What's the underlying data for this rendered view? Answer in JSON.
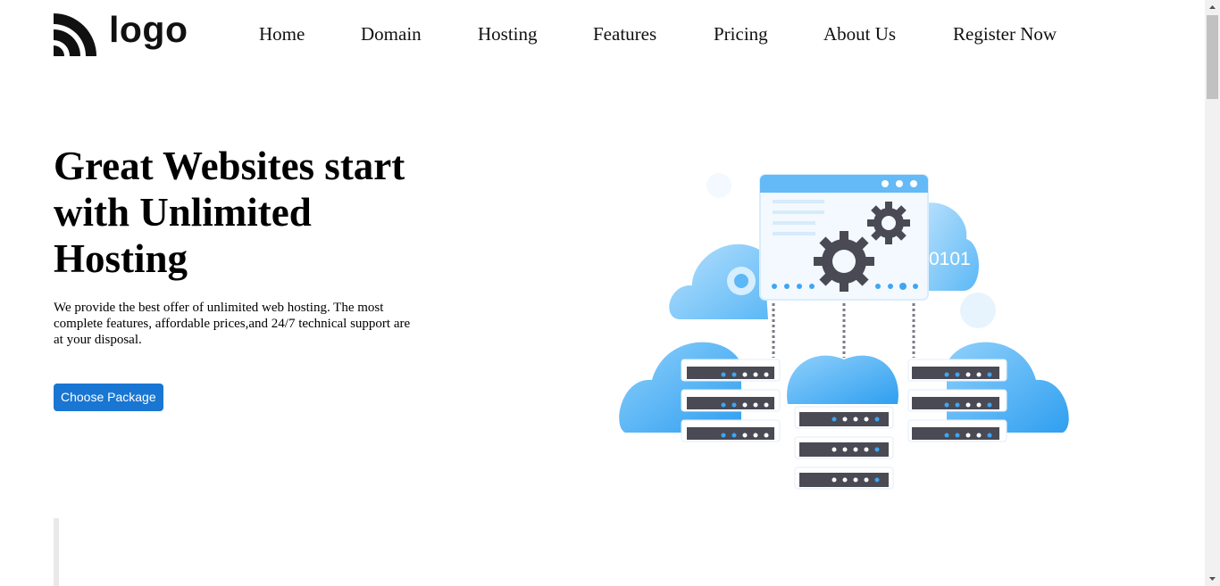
{
  "brand": {
    "logo_text": "logo"
  },
  "nav": {
    "items": [
      "Home",
      "Domain",
      "Hosting",
      "Features",
      "Pricing",
      "About Us",
      "Register Now"
    ]
  },
  "hero": {
    "headline": "Great Websites start with Unlimited Hosting",
    "subtext": "We provide the best offer of unlimited web hosting. The most complete features, affordable prices,and 24/7 technical support are at your disposal.",
    "cta_label": "Choose Package",
    "illustration_text": "0101"
  },
  "colors": {
    "primary_button": "#1976d2",
    "cloud_blue": "#4fb3f6",
    "server_dark": "#4a4a55",
    "gear_dark": "#4a4a55"
  }
}
